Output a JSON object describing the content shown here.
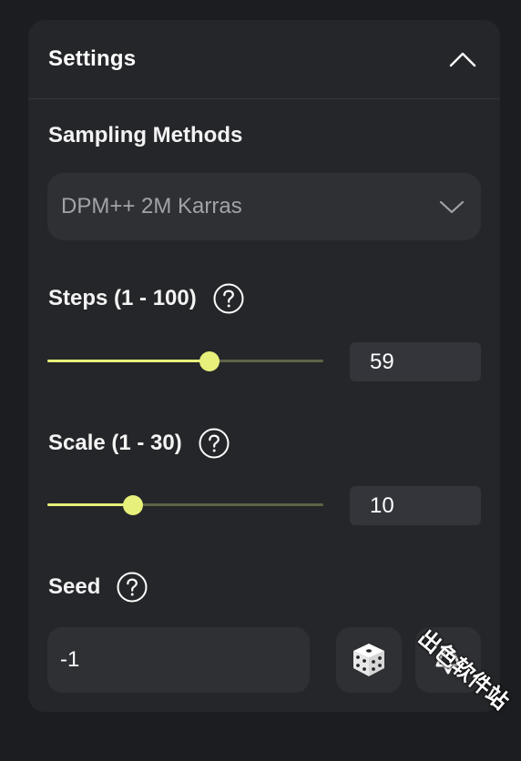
{
  "settings": {
    "title": "Settings",
    "sampling": {
      "label": "Sampling Methods",
      "selected": "DPM++ 2M Karras"
    },
    "steps": {
      "label": "Steps (1 - 100)",
      "value": "59",
      "min": 1,
      "max": 100
    },
    "scale": {
      "label": "Scale (1 - 30)",
      "value": "10",
      "min": 1,
      "max": 30
    },
    "seed": {
      "label": "Seed",
      "value": "-1"
    }
  },
  "watermark": "出色软件站",
  "colors": {
    "background": "#1c1d20",
    "panel": "#252629",
    "accent": "#e6f07a",
    "track": "#5d6346",
    "field": "#2f3034"
  },
  "icons": {
    "collapse": "chevron-up-icon",
    "dropdown": "chevron-down-icon",
    "help": "question-circle-icon",
    "random": "dice-icon",
    "recycle": "recycle-icon"
  }
}
